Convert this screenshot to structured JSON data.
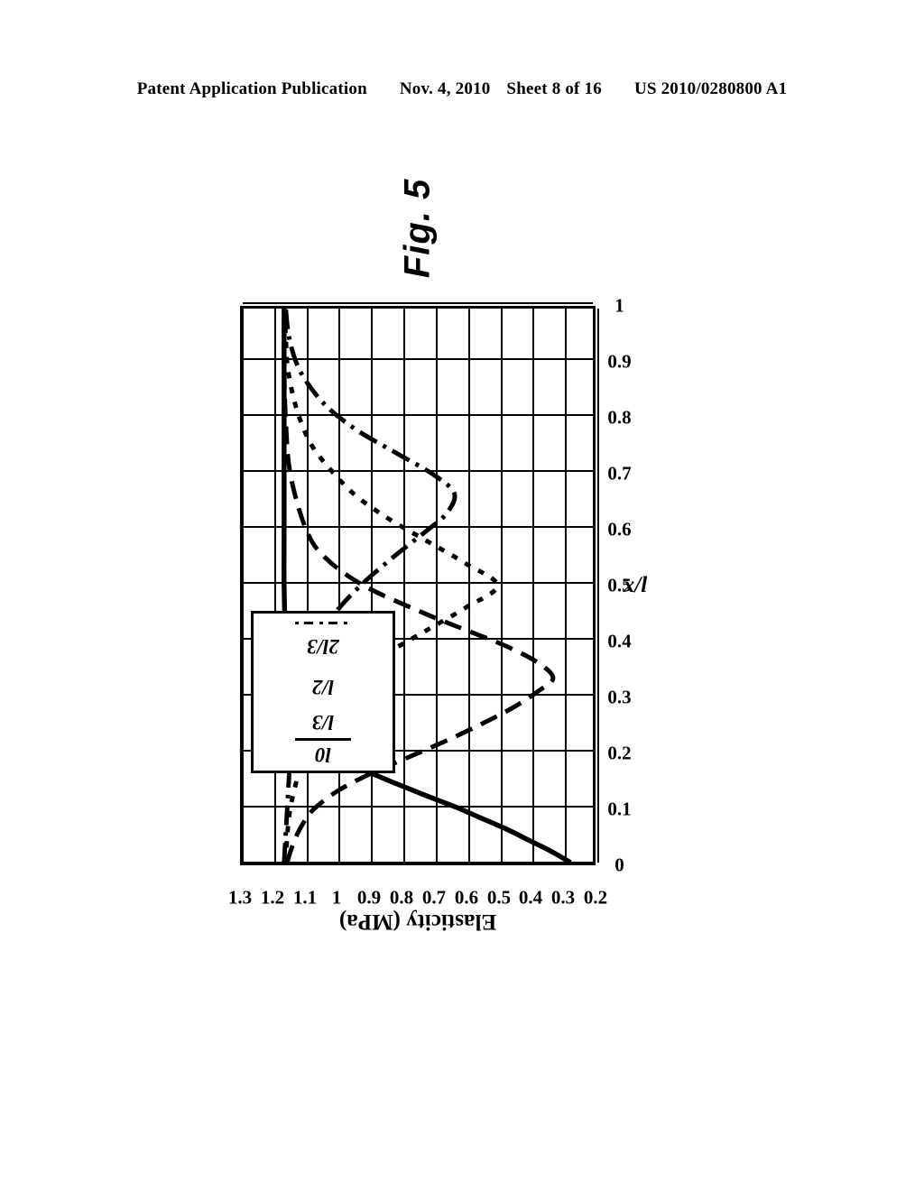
{
  "header": {
    "publication": "Patent Application Publication",
    "date": "Nov. 4, 2010",
    "sheet": "Sheet 8 of 16",
    "number": "US 2010/0280800 A1"
  },
  "figure": {
    "caption": "Fig. 5"
  },
  "chart_data": {
    "type": "line",
    "title": "",
    "xlabel": "x/l",
    "ylabel": "Elasticity (MPa)",
    "xlim": [
      0,
      1
    ],
    "ylim": [
      0.2,
      1.3
    ],
    "xticks": [
      "0",
      "0.1",
      "0.2",
      "0.3",
      "0.4",
      "0.5",
      "0.6",
      "0.7",
      "0.8",
      "0.9",
      "1"
    ],
    "yticks": [
      "0.2",
      "0.3",
      "0.4",
      "0.5",
      "0.6",
      "0.7",
      "0.8",
      "0.9",
      "1",
      "1.1",
      "1.2",
      "1.3"
    ],
    "grid": true,
    "legend_position": "upper-right",
    "orientation": "rotated-90-ccw",
    "series": [
      {
        "name": "l0",
        "style": "solid",
        "x": [
          0,
          0.02,
          0.04,
          0.06,
          0.08,
          0.1,
          0.12,
          0.15,
          0.18,
          0.2,
          0.25,
          0.3,
          0.4,
          0.5,
          0.6,
          0.7,
          0.8,
          0.9,
          1
        ],
        "y": [
          0.27,
          0.33,
          0.4,
          0.47,
          0.55,
          0.63,
          0.72,
          0.85,
          0.97,
          1.03,
          1.12,
          1.15,
          1.165,
          1.17,
          1.17,
          1.17,
          1.17,
          1.17,
          1.17
        ]
      },
      {
        "name": "l/3",
        "style": "dashed",
        "x": [
          0,
          0.02,
          0.05,
          0.08,
          0.1,
          0.13,
          0.16,
          0.19,
          0.22,
          0.25,
          0.28,
          0.31,
          0.333,
          0.36,
          0.39,
          0.42,
          0.45,
          0.5,
          0.55,
          0.6,
          0.7,
          0.8,
          0.9,
          1
        ],
        "y": [
          1.16,
          1.15,
          1.13,
          1.1,
          1.07,
          1.0,
          0.9,
          0.78,
          0.66,
          0.55,
          0.45,
          0.37,
          0.325,
          0.37,
          0.47,
          0.6,
          0.73,
          0.92,
          1.04,
          1.1,
          1.15,
          1.165,
          1.17,
          1.17
        ]
      },
      {
        "name": "l/2",
        "style": "dotted",
        "x": [
          0,
          0.05,
          0.1,
          0.15,
          0.2,
          0.25,
          0.3,
          0.34,
          0.38,
          0.42,
          0.46,
          0.5,
          0.54,
          0.58,
          0.62,
          0.66,
          0.7,
          0.75,
          0.8,
          0.85,
          0.9,
          0.95,
          1
        ],
        "y": [
          1.165,
          1.16,
          1.15,
          1.13,
          1.11,
          1.07,
          1.01,
          0.94,
          0.84,
          0.72,
          0.6,
          0.5,
          0.6,
          0.72,
          0.84,
          0.94,
          1.01,
          1.08,
          1.12,
          1.145,
          1.16,
          1.165,
          1.17
        ]
      },
      {
        "name": "2l/3",
        "style": "dashdot",
        "x": [
          0,
          0.05,
          0.1,
          0.15,
          0.2,
          0.25,
          0.3,
          0.35,
          0.4,
          0.45,
          0.5,
          0.55,
          0.6,
          0.63,
          0.666,
          0.7,
          0.74,
          0.78,
          0.82,
          0.86,
          0.9,
          0.95,
          1
        ],
        "y": [
          1.17,
          1.165,
          1.16,
          1.155,
          1.15,
          1.14,
          1.12,
          1.1,
          1.06,
          1.01,
          0.93,
          0.83,
          0.72,
          0.66,
          0.635,
          0.7,
          0.82,
          0.94,
          1.03,
          1.09,
          1.13,
          1.155,
          1.165
        ]
      }
    ],
    "legend": [
      {
        "label": "l0",
        "style": "solid"
      },
      {
        "label": "l/3",
        "style": "dashed"
      },
      {
        "label": "l/2",
        "style": "dotted"
      },
      {
        "label": "2l/3",
        "style": "dashdot"
      }
    ]
  }
}
